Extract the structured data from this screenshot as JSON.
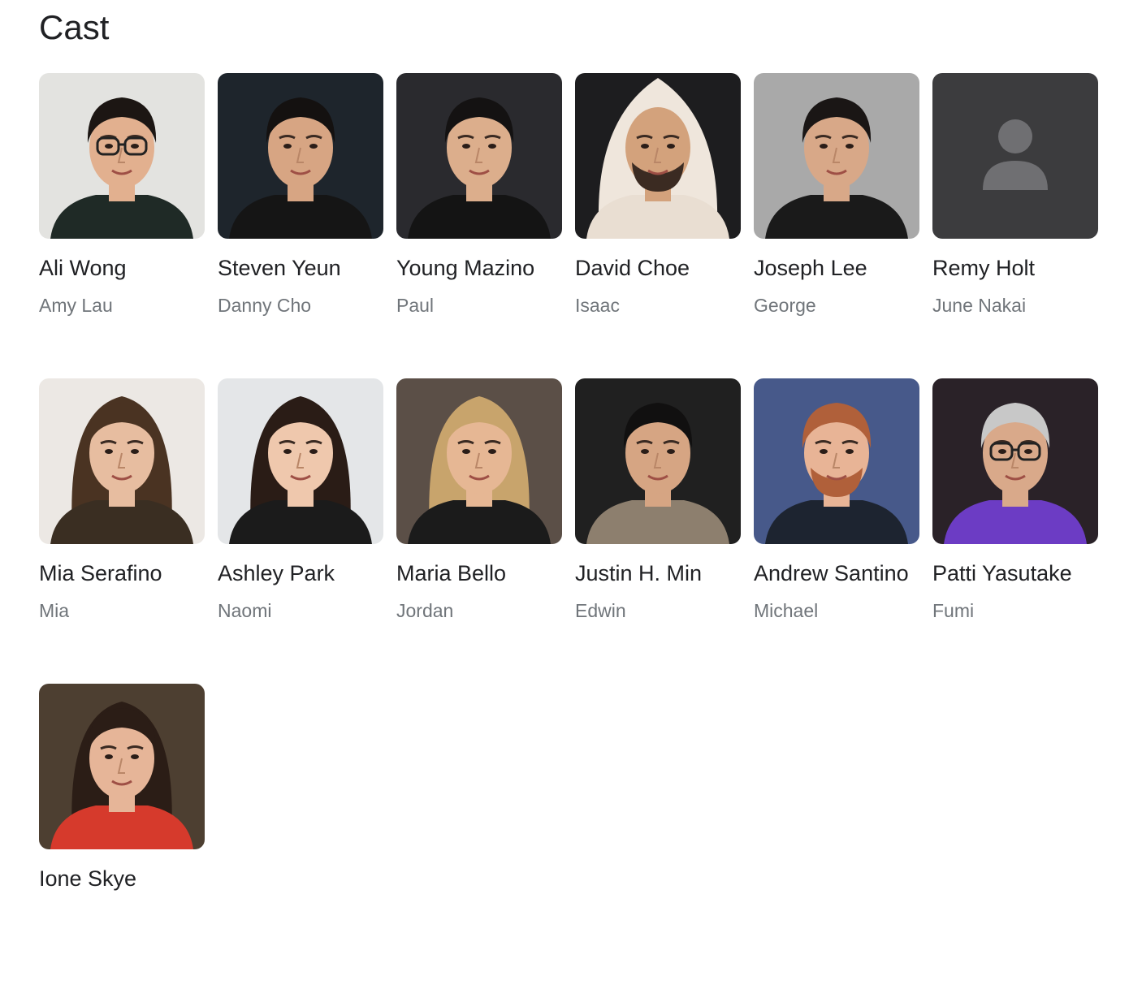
{
  "section": {
    "title": "Cast"
  },
  "cast": [
    {
      "name": "Ali Wong",
      "role": "Amy Lau",
      "photo": "portrait",
      "bg": "#e3e3e0",
      "skin": "#e2b08f",
      "hair": "#1c1613",
      "top": "#1f2a26",
      "glasses": true
    },
    {
      "name": "Steven Yeun",
      "role": "Danny Cho",
      "photo": "portrait",
      "bg": "#1e252c",
      "skin": "#d7a583",
      "hair": "#141110",
      "top": "#151515"
    },
    {
      "name": "Young Mazino",
      "role": "Paul",
      "photo": "portrait",
      "bg": "#2a2a2e",
      "skin": "#dcae8c",
      "hair": "#141212",
      "top": "#141414"
    },
    {
      "name": "David Choe",
      "role": "Isaac",
      "photo": "portrait",
      "bg": "#1d1d1f",
      "skin": "#d3a27c",
      "hair": "#efe6dc",
      "top": "#e9ded2",
      "hood": true,
      "beard": true
    },
    {
      "name": "Joseph Lee",
      "role": "George",
      "photo": "portrait",
      "bg": "#a9a9a9",
      "skin": "#d8a888",
      "hair": "#1a1615",
      "top": "#1a1a1a"
    },
    {
      "name": "Remy Holt",
      "role": "June Nakai",
      "photo": "placeholder",
      "bg": "#3c3c3e",
      "icon": "#6f6f72"
    },
    {
      "name": "Mia Serafino",
      "role": "Mia",
      "photo": "portrait",
      "bg": "#ece8e4",
      "skin": "#e7bda0",
      "hair": "#4a3322",
      "top": "#3a2e22",
      "longhair": true
    },
    {
      "name": "Ashley Park",
      "role": "Naomi",
      "photo": "portrait",
      "bg": "#e4e6e8",
      "skin": "#efc8ad",
      "hair": "#2a1c16",
      "top": "#1b1b1b",
      "longhair": true
    },
    {
      "name": "Maria Bello",
      "role": "Jordan",
      "photo": "portrait",
      "bg": "#5b4f47",
      "skin": "#e6b794",
      "hair": "#c8a46c",
      "top": "#1b1b1b",
      "longhair": true
    },
    {
      "name": "Justin H. Min",
      "role": "Edwin",
      "photo": "portrait",
      "bg": "#202020",
      "skin": "#d6a583",
      "hair": "#111010",
      "top": "#8d7f6e"
    },
    {
      "name": "Andrew Santino",
      "role": "Michael",
      "photo": "portrait",
      "bg": "#47598a",
      "skin": "#e8b496",
      "hair": "#b0603a",
      "top": "#1d2430",
      "beard": true
    },
    {
      "name": "Patti Yasutake",
      "role": "Fumi",
      "photo": "portrait",
      "bg": "#2a2228",
      "skin": "#d9a98a",
      "hair": "#c8c8c8",
      "top": "#6c3cc4",
      "glasses": true
    },
    {
      "name": "Ione Skye",
      "role": "",
      "photo": "portrait",
      "bg": "#4d3f31",
      "skin": "#e6b598",
      "hair": "#2b1d16",
      "top": "#d63a2c",
      "longhair": true
    }
  ]
}
